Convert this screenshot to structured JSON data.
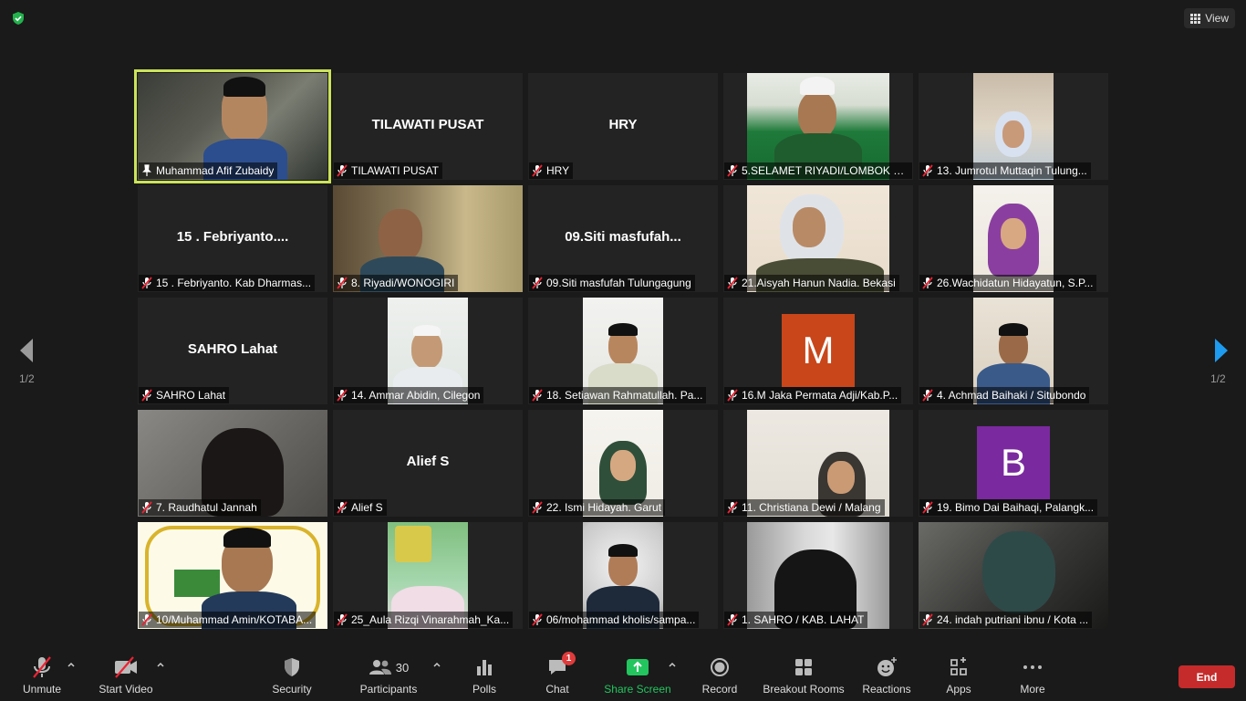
{
  "top": {
    "view_label": "View"
  },
  "tiles": [
    {
      "name": "Muhammad Afif Zubaidy"
    },
    {
      "name": "TILAWATI PUSAT",
      "big": "TILAWATI PUSAT"
    },
    {
      "name": "HRY",
      "big": "HRY"
    },
    {
      "name": "5.SELAMET RIYADI/LOMBOK B..."
    },
    {
      "name": "13. Jumrotul Muttaqin Tulung..."
    },
    {
      "name": "15 . Febriyanto. Kab Dharmas...",
      "big": "15 . Febriyanto...."
    },
    {
      "name": "8. Riyadi/WONOGIRI"
    },
    {
      "name": "09.Siti masfufah Tulungagung",
      "big": "09.Siti masfufah..."
    },
    {
      "name": "21.Aisyah Hanun Nadia. Bekasi"
    },
    {
      "name": "26.Wachidatun Hidayatun, S.P..."
    },
    {
      "name": "SAHRO Lahat",
      "big": "SAHRO Lahat"
    },
    {
      "name": "14. Ammar Abidin, Cilegon"
    },
    {
      "name": "18. Setiawan Rahmatullah. Pa..."
    },
    {
      "name": "16.M Jaka Permata Adji/Kab.P...",
      "avatar": "M"
    },
    {
      "name": "4. Achmad Baihaki / Situbondo"
    },
    {
      "name": "7. Raudhatul Jannah"
    },
    {
      "name": "Alief S",
      "big": "Alief S"
    },
    {
      "name": "22. Ismi Hidayah. Garut"
    },
    {
      "name": "11. Christiana Dewi / Malang"
    },
    {
      "name": "19. Bimo Dai Baihaqi, Palangk...",
      "avatar": "B"
    },
    {
      "name": "10/Muhammad Amin/KOTABA..."
    },
    {
      "name": "25_Aula Rizqi Vinarahmah_Ka..."
    },
    {
      "name": "06/mohammad kholis/sampa..."
    },
    {
      "name": "1.  SAHRO / KAB. LAHAT"
    },
    {
      "name": "24. indah putriani ibnu / Kota ..."
    }
  ],
  "pager": {
    "left": "1/2",
    "right": "1/2"
  },
  "toolbar": {
    "unmute": "Unmute",
    "start_video": "Start Video",
    "security": "Security",
    "participants": "Participants",
    "participants_count": "30",
    "polls": "Polls",
    "chat": "Chat",
    "chat_badge": "1",
    "share_screen": "Share Screen",
    "record": "Record",
    "breakout": "Breakout Rooms",
    "reactions": "Reactions",
    "apps": "Apps",
    "more": "More",
    "end": "End"
  },
  "colors": {
    "active_border": "#cbe35a",
    "avatar_m": "#c8461a",
    "avatar_b": "#7a2a9e",
    "share_green": "#22c55e",
    "end_red": "#c52b2b"
  }
}
